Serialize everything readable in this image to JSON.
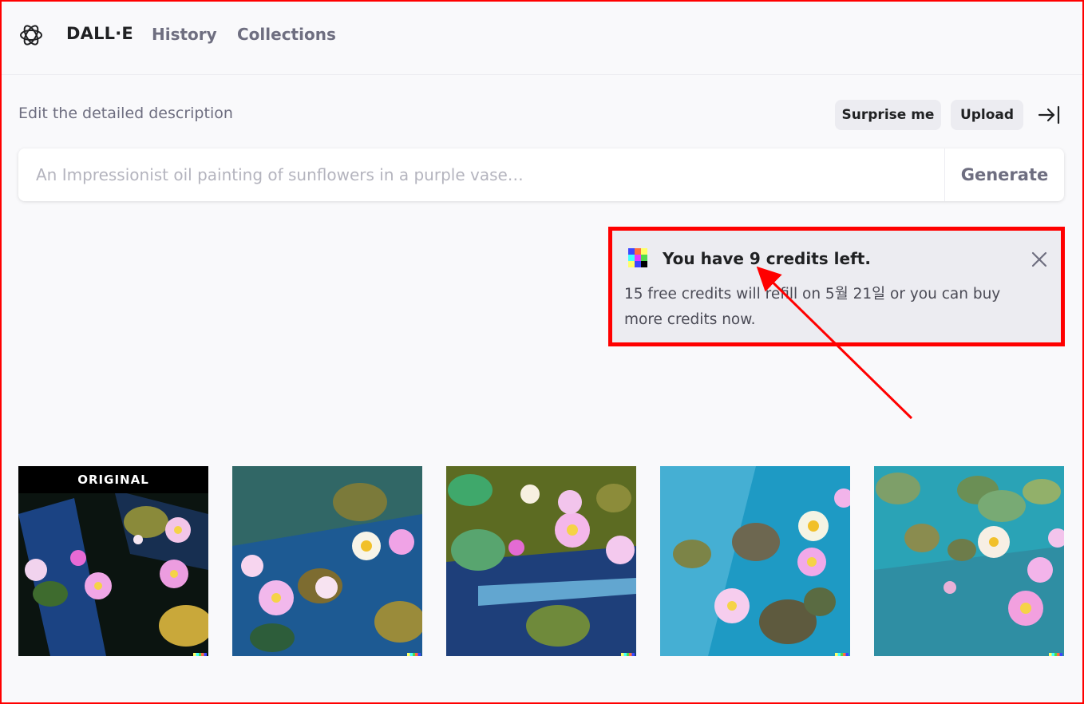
{
  "nav": {
    "brand": "DALL·E",
    "links": [
      "History",
      "Collections"
    ]
  },
  "editor": {
    "label": "Edit the detailed description",
    "surprise_label": "Surprise me",
    "upload_label": "Upload",
    "prompt_placeholder": "An Impressionist oil painting of sunflowers in a purple vase…",
    "prompt_value": "",
    "generate_label": "Generate"
  },
  "toast": {
    "title": "You have 9 credits left.",
    "body": "15 free credits will refill on 5월 21일 or you can buy more credits now."
  },
  "gallery": {
    "original_label": "ORIGINAL"
  },
  "colors": {
    "annotation": "#ff0000",
    "toast_bg": "#ececf1",
    "button_bg": "#ececf1"
  },
  "icons": [
    "openai-logo-icon",
    "collapse-panel-icon",
    "credits-icon",
    "close-icon"
  ]
}
